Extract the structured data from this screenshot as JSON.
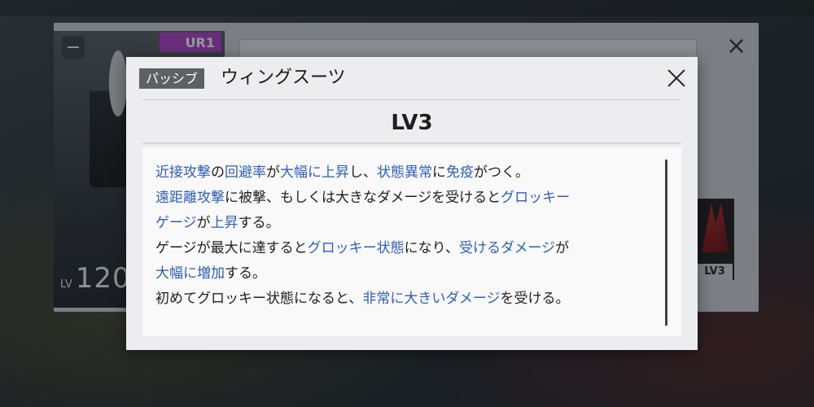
{
  "background": {
    "minus_label": "−",
    "rarity": "UR1",
    "level_prefix": "LV",
    "level_value": "120",
    "close_icon": "×",
    "skill_level": "LV3"
  },
  "modal": {
    "tag": "パッシブ",
    "title": "ウィングスーツ",
    "level": "LV3",
    "description_lines": [
      [
        {
          "t": "近接攻撃",
          "h": true
        },
        {
          "t": "の",
          "h": false
        },
        {
          "t": "回避率",
          "h": true
        },
        {
          "t": "が",
          "h": false
        },
        {
          "t": "大幅に上昇",
          "h": true
        },
        {
          "t": "し、",
          "h": false
        },
        {
          "t": "状態異常",
          "h": true
        },
        {
          "t": "に",
          "h": false
        },
        {
          "t": "免疫",
          "h": true
        },
        {
          "t": "がつく。",
          "h": false
        }
      ],
      [
        {
          "t": "遠距離攻撃",
          "h": true
        },
        {
          "t": "に被撃、もしくは大きなダメージを受けると",
          "h": false
        },
        {
          "t": "グロッキー",
          "h": true
        }
      ],
      [
        {
          "t": "ゲージ",
          "h": true
        },
        {
          "t": "が",
          "h": false
        },
        {
          "t": "上昇",
          "h": true
        },
        {
          "t": "する。",
          "h": false
        }
      ],
      [
        {
          "t": "ゲージが最大に達すると",
          "h": false
        },
        {
          "t": "グロッキー状態",
          "h": true
        },
        {
          "t": "になり、",
          "h": false
        },
        {
          "t": "受けるダメージ",
          "h": true
        },
        {
          "t": "が",
          "h": false
        }
      ],
      [
        {
          "t": "大幅に増加",
          "h": true
        },
        {
          "t": "する。",
          "h": false
        }
      ],
      [
        {
          "t": "初めてグロッキー状態になると、",
          "h": false
        },
        {
          "t": "非常に大きいダメージ",
          "h": true
        },
        {
          "t": "を受ける。",
          "h": false
        }
      ]
    ],
    "highlight_color": "#2f5fb5"
  }
}
